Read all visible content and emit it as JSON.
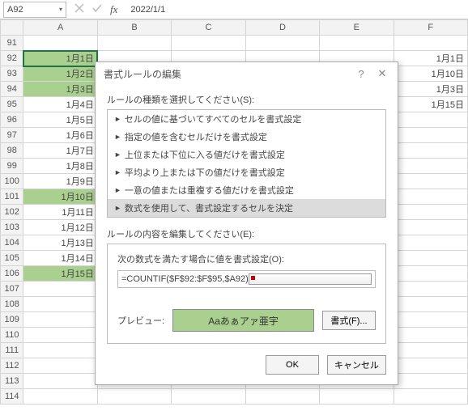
{
  "namebox": "A92",
  "formula_bar": "2022/1/1",
  "columns": [
    "A",
    "B",
    "C",
    "D",
    "E",
    "F"
  ],
  "rows": [
    {
      "n": 91,
      "a": "",
      "f": "",
      "hl": false
    },
    {
      "n": 92,
      "a": "1月1日",
      "f": "1月1日",
      "hl": true,
      "active": true
    },
    {
      "n": 93,
      "a": "1月2日",
      "f": "1月10日",
      "hl": true
    },
    {
      "n": 94,
      "a": "1月3日",
      "f": "1月3日",
      "hl": true
    },
    {
      "n": 95,
      "a": "1月4日",
      "f": "1月15日",
      "hl": false
    },
    {
      "n": 96,
      "a": "1月5日",
      "f": "",
      "hl": false
    },
    {
      "n": 97,
      "a": "1月6日",
      "f": "",
      "hl": false
    },
    {
      "n": 98,
      "a": "1月7日",
      "f": "",
      "hl": false
    },
    {
      "n": 99,
      "a": "1月8日",
      "f": "",
      "hl": false
    },
    {
      "n": 100,
      "a": "1月9日",
      "f": "",
      "hl": false
    },
    {
      "n": 101,
      "a": "1月10日",
      "f": "",
      "hl": true
    },
    {
      "n": 102,
      "a": "1月11日",
      "f": "",
      "hl": false
    },
    {
      "n": 103,
      "a": "1月12日",
      "f": "",
      "hl": false
    },
    {
      "n": 104,
      "a": "1月13日",
      "f": "",
      "hl": false
    },
    {
      "n": 105,
      "a": "1月14日",
      "f": "",
      "hl": false
    },
    {
      "n": 106,
      "a": "1月15日",
      "f": "",
      "hl": true
    },
    {
      "n": 107,
      "a": "",
      "f": "",
      "hl": false
    },
    {
      "n": 108,
      "a": "",
      "f": "",
      "hl": false
    },
    {
      "n": 109,
      "a": "",
      "f": "",
      "hl": false
    },
    {
      "n": 110,
      "a": "",
      "f": "",
      "hl": false
    },
    {
      "n": 111,
      "a": "",
      "f": "",
      "hl": false
    },
    {
      "n": 112,
      "a": "",
      "f": "",
      "hl": false
    },
    {
      "n": 113,
      "a": "",
      "f": "",
      "hl": false
    },
    {
      "n": 114,
      "a": "",
      "f": "",
      "hl": false
    }
  ],
  "dialog": {
    "title": "書式ルールの編集",
    "sect1": "ルールの種類を選択してください(S):",
    "rule_types": [
      "セルの値に基づいてすべてのセルを書式設定",
      "指定の値を含むセルだけを書式設定",
      "上位または下位に入る値だけを書式設定",
      "平均より上または下の値だけを書式設定",
      "一意の値または重複する値だけを書式設定",
      "数式を使用して、書式設定するセルを決定"
    ],
    "selected_rule_index": 5,
    "sect2": "ルールの内容を編集してください(E):",
    "formula_label": "次の数式を満たす場合に値を書式設定(O):",
    "formula_value": "=COUNTIF($F$92:$F$95,$A92)",
    "preview_label": "プレビュー:",
    "preview_sample": "Aaあぁアァ亜宇",
    "format_btn": "書式(F)...",
    "ok": "OK",
    "cancel": "キャンセル"
  }
}
